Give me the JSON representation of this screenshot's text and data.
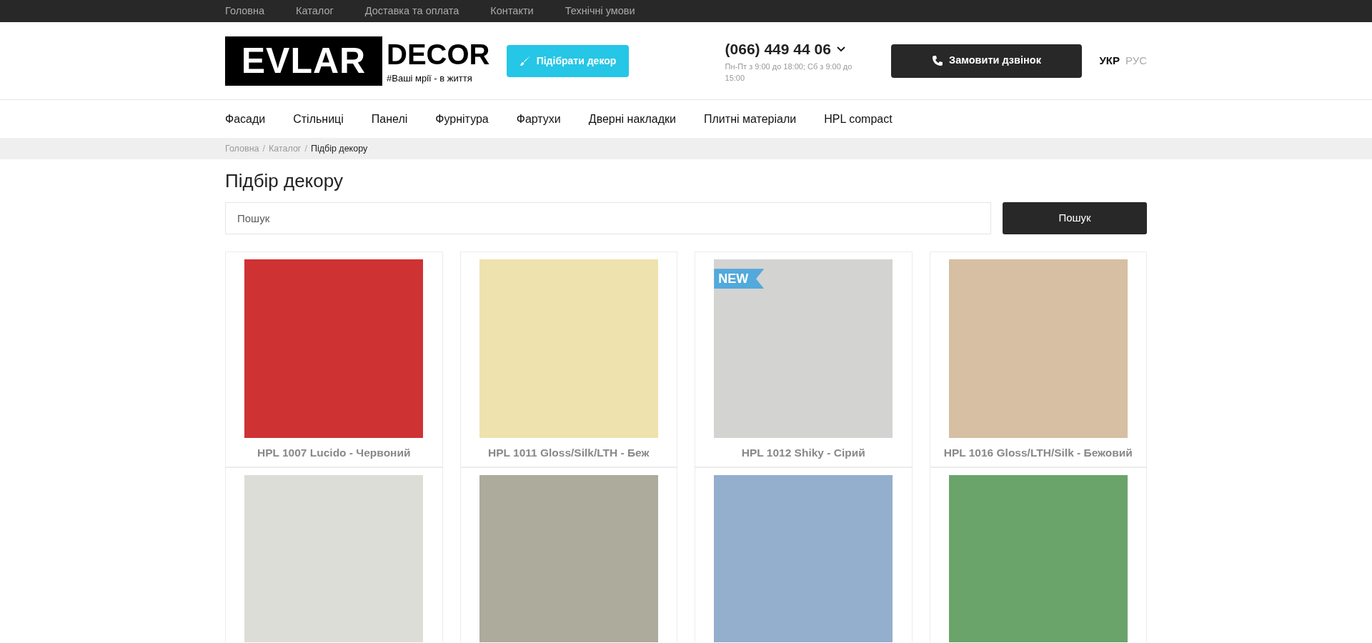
{
  "top_menu": [
    {
      "label": "Головна"
    },
    {
      "label": "Каталог"
    },
    {
      "label": "Доставка та оплата"
    },
    {
      "label": "Контакти"
    },
    {
      "label": "Технічні умови"
    }
  ],
  "logo": {
    "word_1": "EVLAR",
    "word_2": "DECOR",
    "tagline": "#Ваші мрії - в життя"
  },
  "pick_button": "Підібрати декор",
  "phone": {
    "number": "(066) 449 44 06",
    "hours": "Пн-Пт з 9:00 до 18:00; Сб з 9:00 до 15:00"
  },
  "call_button": "Замовити дзвінок",
  "languages": [
    {
      "label": "УКР",
      "selected": true
    },
    {
      "label": "РУС",
      "selected": false
    }
  ],
  "main_menu": [
    {
      "label": "Фасади"
    },
    {
      "label": "Стільниці"
    },
    {
      "label": "Панелі"
    },
    {
      "label": "Фурнітура"
    },
    {
      "label": "Фартухи"
    },
    {
      "label": "Дверні накладки"
    },
    {
      "label": "Плитні матеріали"
    },
    {
      "label": "HPL compact"
    }
  ],
  "breadcrumb_separator": "/",
  "breadcrumb": [
    {
      "label": "Головна"
    },
    {
      "label": "Каталог"
    },
    {
      "label": "Підбір декору"
    }
  ],
  "page_title": "Підбір декору",
  "search": {
    "placeholder": "Пошук",
    "button": "Пошук"
  },
  "products": [
    {
      "name": "HPL 1007 Lucido - Червоний",
      "color": "#cf3233"
    },
    {
      "name": "HPL 1011 Gloss/Silk/LTH - Беж",
      "color": "#eee2ae"
    },
    {
      "name": "HPL 1012 Shiky - Сірий",
      "color": "#d3d3d1",
      "badge": "NEW"
    },
    {
      "name": "HPL 1016 Gloss/LTH/Silk - Бежовий",
      "color": "#d6bfa2"
    },
    {
      "color": "#dcddd6"
    },
    {
      "color": "#acab9c"
    },
    {
      "color": "#94aecd"
    },
    {
      "color": "#6aa46a"
    }
  ]
}
